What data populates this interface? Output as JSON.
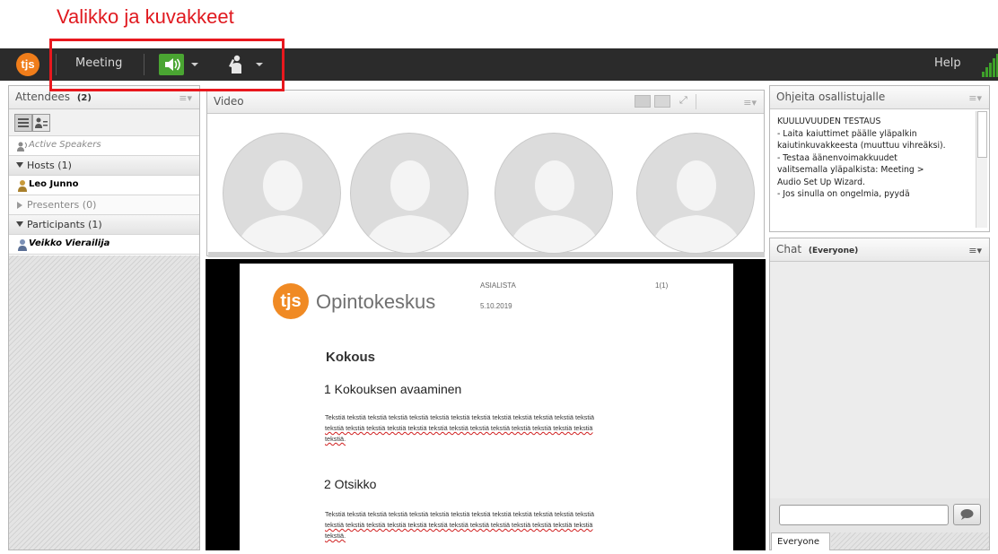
{
  "annotation": {
    "text": "Valikko ja kuvakkeet",
    "color": "#e0191f"
  },
  "topbar": {
    "logo_text": "tjs",
    "menu_label": "Meeting",
    "help_label": "Help",
    "audio_icon": "speaker-icon",
    "status_icon": "hand-raise-icon",
    "signal_icon": "signal-bars-icon",
    "accent": "#4aa532"
  },
  "attendees": {
    "title": "Attendees",
    "count": "(2)",
    "active_speakers": "Active Speakers",
    "sections": {
      "hosts": "Hosts (1)",
      "presenters": "Presenters (0)",
      "participants": "Participants (1)"
    },
    "host": "Leo Junno",
    "participant": "Veikko Vierailija"
  },
  "video": {
    "title": "Video"
  },
  "document": {
    "logo_text": "Opintokeskus",
    "logo_mark": "tjs",
    "doc_title": "ASIALISTA",
    "page": "1(1)",
    "date": "5.10.2019",
    "heading": "Kokous",
    "section1": "1 Kokouksen avaaminen",
    "body_line1": "Tekstiä tekstiä tekstiä tekstiä tekstiä tekstiä tekstiä tekstiä tekstiä tekstiä tekstiä tekstiä tekstiä",
    "body_line2": "tekstiä tekstiä tekstiä tekstiä tekstiä tekstiä tekstiä tekstiä tekstiä tekstiä tekstiä tekstiä tekstiä",
    "body_line3": "tekstiä.",
    "section2": "2 Otsikko"
  },
  "instructions": {
    "title": "Ohjeita osallistujalle",
    "lines": [
      "KUULUVUUDEN TESTAUS",
      "- Laita kaiuttimet päälle yläpalkin",
      "kaiutinkuvakkeesta (muuttuu vihreäksi).",
      "- Testaa äänenvoimakkuudet",
      "valitsemalla yläpalkista: Meeting >",
      "Audio Set Up Wizard.",
      "- Jos sinulla on ongelmia, pyydä"
    ]
  },
  "chat": {
    "title": "Chat",
    "scope": "(Everyone)",
    "tab_label": "Everyone",
    "input_value": "",
    "send_icon": "speech-bubble-icon"
  }
}
